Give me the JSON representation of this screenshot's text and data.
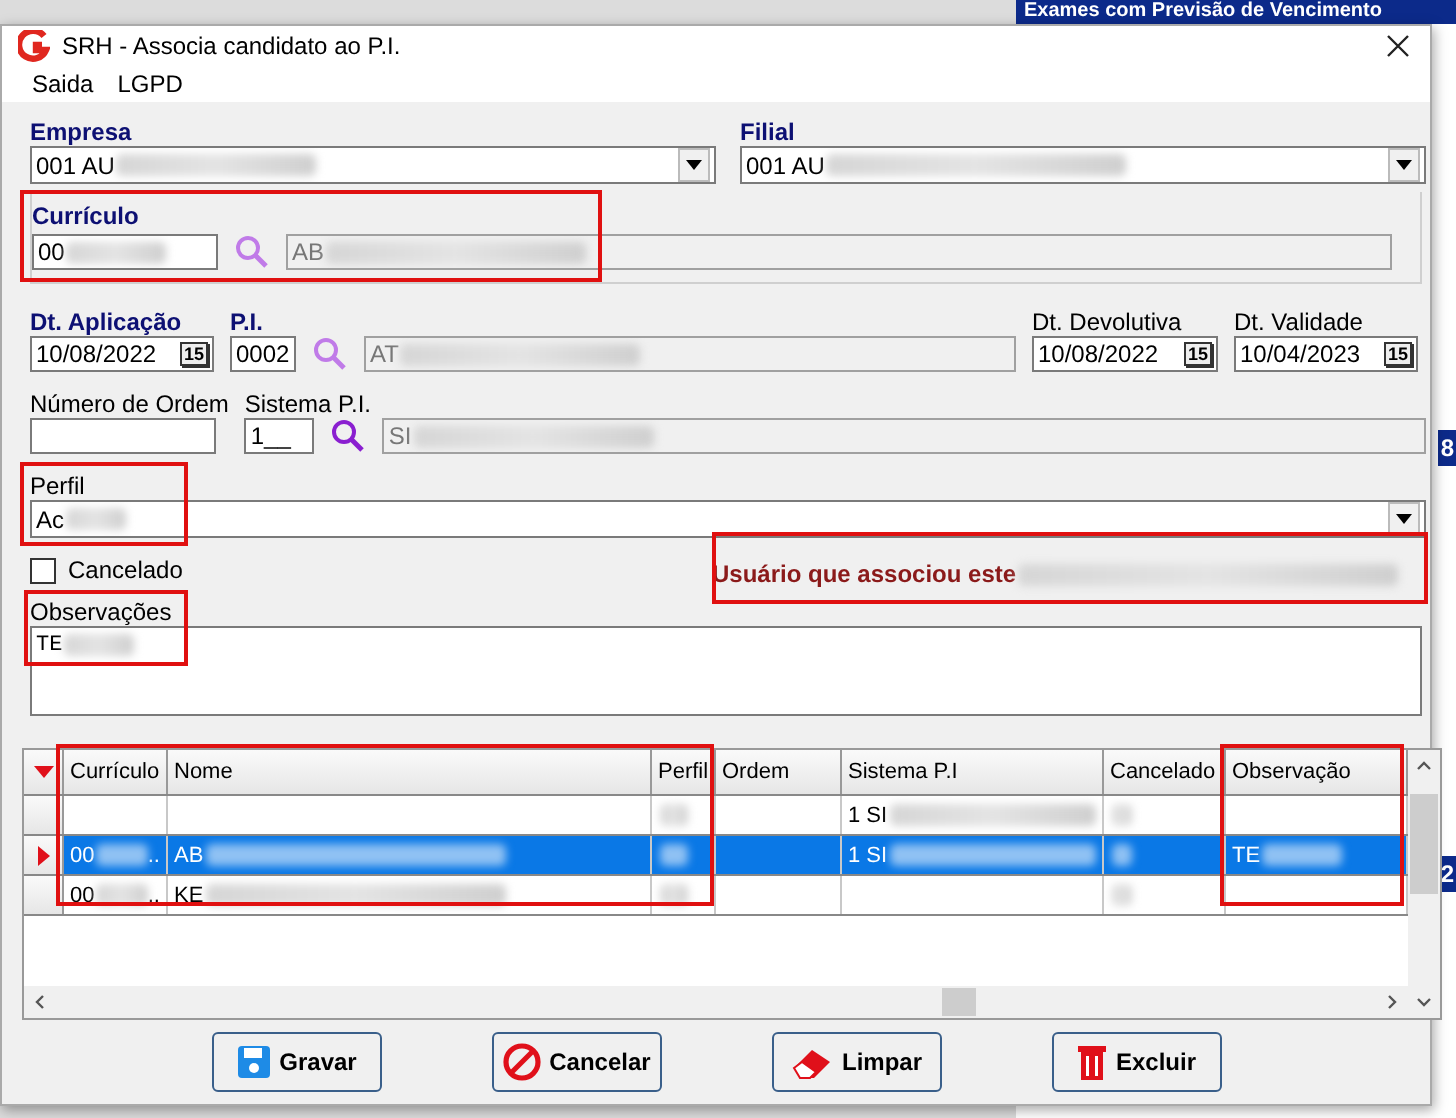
{
  "background_window": {
    "title": "Exames com Previsão de Vencimento",
    "side_marks": [
      "8",
      "2"
    ]
  },
  "window": {
    "title": "SRH - Associa candidato ao P.I."
  },
  "menu": [
    "Saida",
    "LGPD"
  ],
  "empresa": {
    "label": "Empresa",
    "value": "001 AU",
    "redacted": true
  },
  "filial": {
    "label": "Filial",
    "value": "001 AU",
    "redacted": true
  },
  "curriculo": {
    "label": "Currículo",
    "code": "00",
    "name": "AB",
    "redacted": true
  },
  "dt_aplicacao": {
    "label": "Dt. Aplicação",
    "value": "10/08/2022",
    "calendar": "15"
  },
  "pi": {
    "label": "P.I.",
    "code": "0002",
    "name": "AT",
    "redacted": true
  },
  "dt_devolutiva": {
    "label": "Dt. Devolutiva",
    "value": "10/08/2022",
    "calendar": "15"
  },
  "dt_validade": {
    "label": "Dt. Validade",
    "value": "10/04/2023",
    "calendar": "15"
  },
  "numero_ordem": {
    "label": "Número de Ordem"
  },
  "sistema_pi": {
    "label": "Sistema P.I.",
    "code": "1__",
    "name": "SI",
    "redacted": true
  },
  "perfil": {
    "label": "Perfil",
    "value": "Ac",
    "redacted": true
  },
  "cancelado": {
    "label": "Cancelado",
    "checked": false
  },
  "usuario_note": {
    "text": "Usuário que associou este",
    "redacted": true
  },
  "observacoes": {
    "label": "Observações",
    "value": "TE",
    "redacted": true
  },
  "grid": {
    "columns": [
      "Currículo",
      "Nome",
      "Perfil",
      "Ordem",
      "Sistema P.I",
      "Cancelado",
      "Observação"
    ],
    "rows": [
      {
        "selected": false,
        "cells": [
          {},
          {},
          {
            "redacted": true
          },
          {},
          {
            "text": "1 SI",
            "redacted": true
          },
          {
            "redacted": true
          },
          {}
        ]
      },
      {
        "selected": true,
        "cells": [
          {
            "text": "00",
            "redacted": true,
            "suffix": ".."
          },
          {
            "text": "AB",
            "redacted": true
          },
          {
            "redacted": true
          },
          {},
          {
            "text": "1 SI",
            "redacted": true
          },
          {
            "redacted": true
          },
          {
            "text": "TE",
            "redacted": true
          }
        ]
      },
      {
        "selected": false,
        "cells": [
          {
            "text": "00",
            "redacted": true,
            "suffix": ".."
          },
          {
            "text": "KE",
            "redacted": true
          },
          {
            "redacted": true
          },
          {},
          {},
          {
            "redacted": true
          },
          {}
        ]
      }
    ]
  },
  "buttons": [
    {
      "label": "Gravar",
      "kind": "save"
    },
    {
      "label": "Cancelar",
      "kind": "cancel"
    },
    {
      "label": "Limpar",
      "kind": "clear"
    },
    {
      "label": "Excluir",
      "kind": "delete"
    }
  ]
}
